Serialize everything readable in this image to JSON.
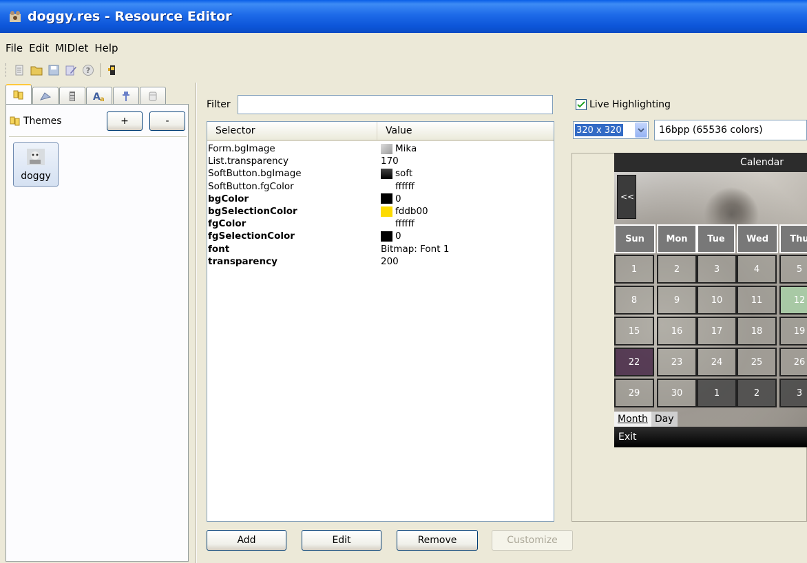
{
  "window": {
    "title": "doggy.res - Resource Editor"
  },
  "menu": [
    "File",
    "Edit",
    "MIDlet",
    "Help"
  ],
  "left": {
    "themes_label": "Themes",
    "add_label": "+",
    "remove_label": "-",
    "theme_items": [
      "doggy"
    ]
  },
  "filter": {
    "label": "Filter",
    "value": ""
  },
  "table": {
    "headers": [
      "Selector",
      "Value"
    ],
    "rows": [
      {
        "selector": "Form.bgImage",
        "value": "Mika",
        "bold": false,
        "kind": "image"
      },
      {
        "selector": "List.transparency",
        "value": "170",
        "bold": false,
        "kind": "text"
      },
      {
        "selector": "SoftButton.bgImage",
        "value": "soft",
        "bold": false,
        "kind": "image-dark"
      },
      {
        "selector": "SoftButton.fgColor",
        "value": "ffffff",
        "bold": false,
        "kind": "color",
        "color": "#ffffff"
      },
      {
        "selector": "bgColor",
        "value": "0",
        "bold": true,
        "kind": "color",
        "color": "#000000"
      },
      {
        "selector": "bgSelectionColor",
        "value": "fddb00",
        "bold": true,
        "kind": "color",
        "color": "#fddb00"
      },
      {
        "selector": "fgColor",
        "value": "ffffff",
        "bold": true,
        "kind": "color",
        "color": "#ffffff"
      },
      {
        "selector": "fgSelectionColor",
        "value": "0",
        "bold": true,
        "kind": "color",
        "color": "#000000"
      },
      {
        "selector": "font",
        "value": "Bitmap: Font 1",
        "bold": true,
        "kind": "text"
      },
      {
        "selector": "transparency",
        "value": "200",
        "bold": true,
        "kind": "text"
      }
    ]
  },
  "buttons": {
    "add": "Add",
    "edit": "Edit",
    "remove": "Remove",
    "customize": "Customize"
  },
  "preview": {
    "live_highlighting": "Live Highlighting",
    "live_checked": true,
    "resolution": "320 x 320",
    "color_depth": "16bpp (65536 colors)",
    "calendar": {
      "title": "Calendar",
      "prev": "<<",
      "days": [
        "Sun",
        "Mon",
        "Tue",
        "Wed",
        "Thu"
      ],
      "weeks": [
        [
          "1",
          "2",
          "3",
          "4",
          "5"
        ],
        [
          "8",
          "9",
          "10",
          "11",
          "12"
        ],
        [
          "15",
          "16",
          "17",
          "18",
          "19"
        ],
        [
          "22",
          "23",
          "24",
          "25",
          "26"
        ],
        [
          "29",
          "30",
          "1",
          "2",
          "3"
        ]
      ],
      "tab_month": "Month",
      "tab_day": "Day",
      "softkey": "Exit"
    }
  }
}
